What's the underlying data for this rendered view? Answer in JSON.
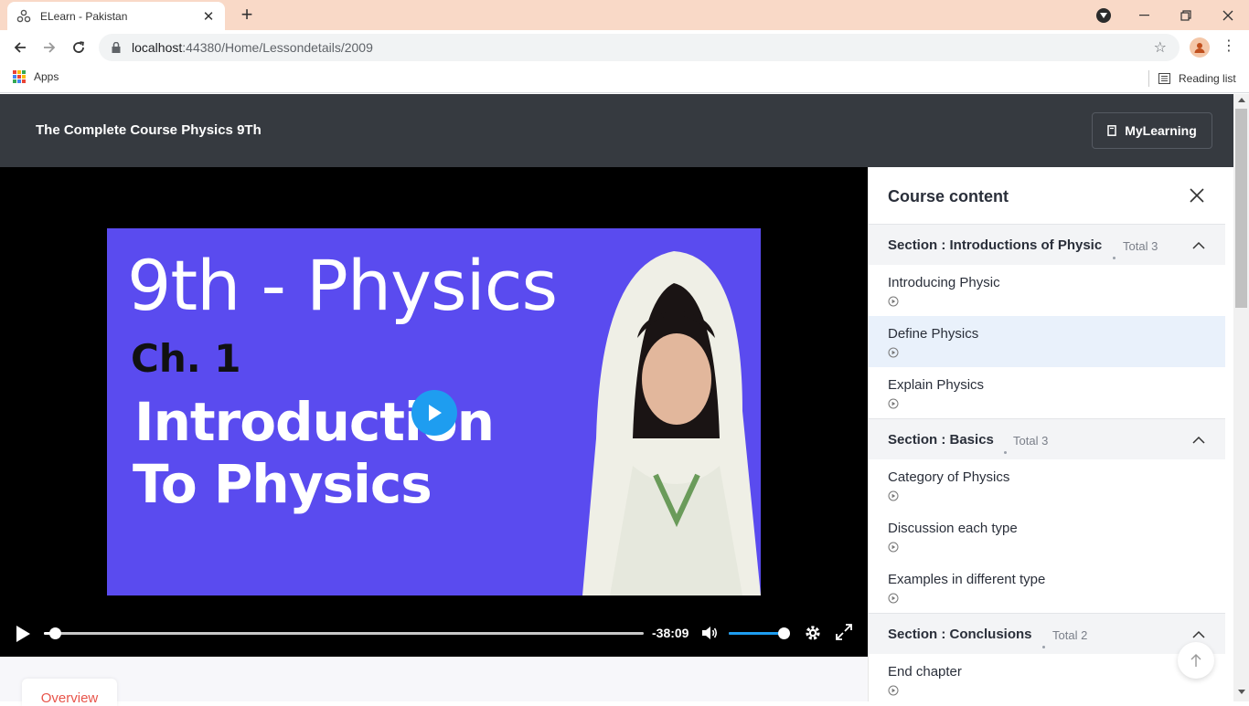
{
  "browser": {
    "tab_title": "ELearn - Pakistan",
    "url_host": "localhost",
    "url_path": ":44380/Home/Lessondetails/2009",
    "bookmarks": {
      "apps_label": "Apps",
      "reading_list_label": "Reading list"
    }
  },
  "header": {
    "course_title": "The Complete Course Physics 9Th",
    "mylearning_label": "MyLearning"
  },
  "video": {
    "thumbnail": {
      "line1": "9th - Physics",
      "line2": "Ch. 1",
      "line3": "Introduction",
      "line4": "To Physics"
    },
    "time_remaining": "-38:09",
    "progress": 0.01,
    "volume": 0.98
  },
  "tabs": {
    "overview_label": "Overview"
  },
  "sidebar": {
    "title": "Course content",
    "sections": [
      {
        "name": "Section : Introductions of Physic",
        "total": "Total 3",
        "lessons": [
          "Introducing Physic",
          "Define Physics",
          "Explain Physics"
        ]
      },
      {
        "name": "Section : Basics",
        "total": "Total 3",
        "lessons": [
          "Category of Physics",
          "Discussion each type",
          "Examples in different type"
        ]
      },
      {
        "name": "Section : Conclusions",
        "total": "Total 2",
        "lessons": [
          "End chapter"
        ]
      }
    ],
    "active_lesson": "Define Physics"
  },
  "colors": {
    "header_bg": "#363a40",
    "accent_blue": "#1e9df0",
    "overview_red": "#e8544a",
    "thumb_bg": "#5a4bef"
  }
}
